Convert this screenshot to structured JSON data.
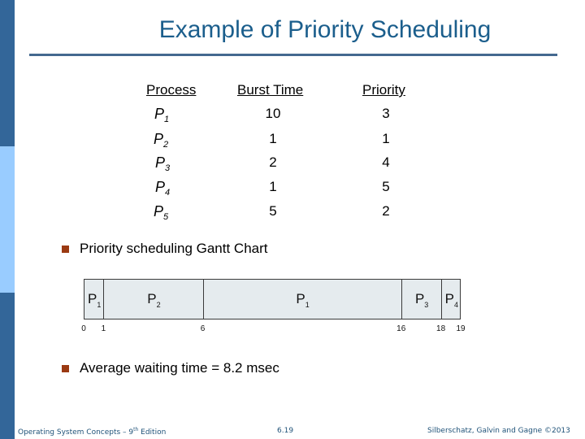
{
  "slide": {
    "title": "Example of Priority Scheduling",
    "colors": {
      "sidebar_dark": "#336699",
      "sidebar_light": "#99CCFF",
      "title": "#1B5E8C",
      "rule": "#44698F",
      "bullet": "#9B3A12",
      "gantt_fill": "#E5EBEE"
    }
  },
  "table": {
    "headers": [
      "Process",
      "Burst Time",
      "Priority"
    ],
    "rows": [
      {
        "process": "P",
        "sub": "1",
        "burst": "10",
        "priority": "3"
      },
      {
        "process": "P",
        "sub": "2",
        "burst": "1",
        "priority": "1"
      },
      {
        "process": "P",
        "sub": "3",
        "burst": "2",
        "priority": "4"
      },
      {
        "process": "P",
        "sub": "4",
        "burst": "1",
        "priority": "5"
      },
      {
        "process": "P",
        "sub": "5",
        "burst": "5",
        "priority": "2"
      }
    ]
  },
  "bullets": [
    {
      "text": "Priority scheduling Gantt Chart",
      "icon": "square-bullet-icon"
    },
    {
      "text": "Average waiting time = 8.2 msec",
      "icon": "square-bullet-icon"
    }
  ],
  "gantt": {
    "total": 19,
    "blocks": [
      {
        "label": "P",
        "sub": "1",
        "start": 0,
        "end": 1
      },
      {
        "label": "P",
        "sub": "2",
        "start": 1,
        "end": 6
      },
      {
        "label": "P",
        "sub": "1",
        "start": 6,
        "end": 16
      },
      {
        "label": "P",
        "sub": "3",
        "start": 16,
        "end": 18
      },
      {
        "label": "P",
        "sub": "4",
        "start": 18,
        "end": 19
      }
    ],
    "ticks": [
      "0",
      "1",
      "6",
      "16",
      "18",
      "19"
    ]
  },
  "footer": {
    "left": "Operating System Concepts – 9",
    "left_sup": "th",
    "left_suffix": " Edition",
    "center": "6.19",
    "right": "Silberschatz, Galvin and Gagne ©2013"
  }
}
